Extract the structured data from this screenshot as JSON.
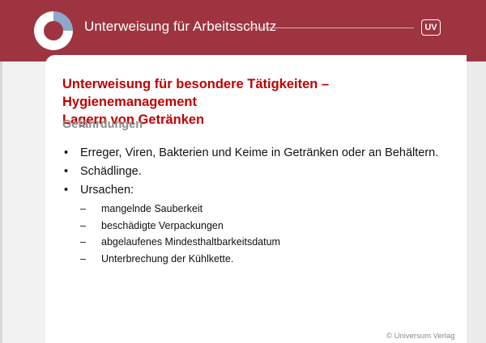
{
  "header": {
    "title": "Unterweisung für Arbeitsschutz",
    "badge": "UV",
    "colors": {
      "accent": "#9e3440",
      "title_red": "#c00000"
    }
  },
  "slide": {
    "title_line1": "Unterweisung für besondere Tätigkeiten – Hygienemanagement",
    "title_line2": "Lagern von Getränken",
    "subtitle": "Gefährdungen",
    "bullets": [
      "Erreger, Viren, Bakterien und Keime in Getränken oder an Behältern.",
      "Schädlinge.",
      "Ursachen:"
    ],
    "sub_items": [
      "mangelnde Sauberkeit",
      "beschädigte Verpackungen",
      "abgelaufenes Mindesthaltbarkeitsdatum",
      "Unterbrechung der Kühlkette."
    ],
    "bullet_symbol": "•",
    "dash_symbol": "–"
  },
  "footer": {
    "copyright": "© Universum Verlag"
  }
}
